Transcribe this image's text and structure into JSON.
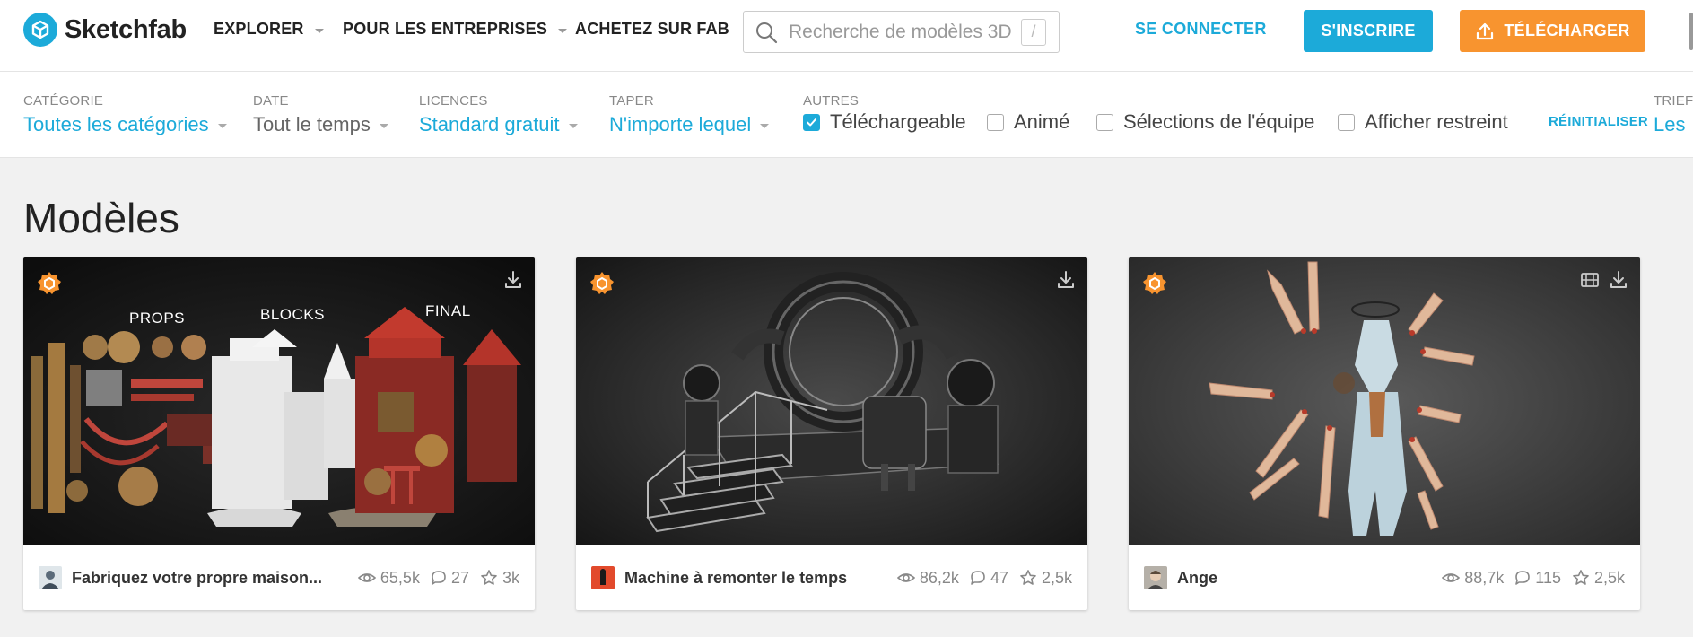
{
  "header": {
    "logo_text": "Sketchfab",
    "nav": [
      {
        "label": "EXPLORER"
      },
      {
        "label": "POUR LES ENTREPRISES"
      },
      {
        "label": "ACHETEZ SUR FAB"
      }
    ],
    "search_placeholder": "Recherche de modèles 3D",
    "search_shortcut": "/",
    "login_label": "SE CONNECTER",
    "signup_label": "S'INSCRIRE",
    "upload_label": "TÉLÉCHARGER"
  },
  "filters": {
    "category": {
      "label": "CATÉGORIE",
      "value": "Toutes les catégories"
    },
    "date": {
      "label": "DATE",
      "value": "Tout le temps"
    },
    "license": {
      "label": "LICENCES",
      "value": "Standard gratuit"
    },
    "type": {
      "label": "TAPER",
      "value": "N'importe lequel"
    },
    "others": {
      "label": "AUTRES",
      "options": [
        {
          "label": "Téléchargeable",
          "checked": true
        },
        {
          "label": "Animé",
          "checked": false
        },
        {
          "label": "Sélections de l'équipe",
          "checked": false
        },
        {
          "label": "Afficher restreint",
          "checked": false
        }
      ]
    },
    "reset_label": "RÉINITIALISER",
    "sort": {
      "label": "TRIEF",
      "value": "Les"
    }
  },
  "main": {
    "heading": "Modèles",
    "models": [
      {
        "title": "Fabriquez votre propre maison...",
        "views": "65,5k",
        "comments": "27",
        "likes": "3k",
        "thumb_labels": [
          "PROPS",
          "BLOCKS",
          "FINAL"
        ]
      },
      {
        "title": "Machine à remonter le temps",
        "views": "86,2k",
        "comments": "47",
        "likes": "2,5k"
      },
      {
        "title": "Ange",
        "views": "88,7k",
        "comments": "115",
        "likes": "2,5k"
      }
    ]
  },
  "colors": {
    "brand_blue": "#1caad9",
    "upload_orange": "#f8942f",
    "staff_pick_orange": "#f8942f"
  },
  "icons": [
    "sketchfab-logo-icon",
    "search-icon",
    "upload-icon",
    "checkbox-checked-icon",
    "staff-pick-icon",
    "download-icon",
    "animated-icon",
    "views-icon",
    "comments-icon",
    "likes-icon"
  ]
}
